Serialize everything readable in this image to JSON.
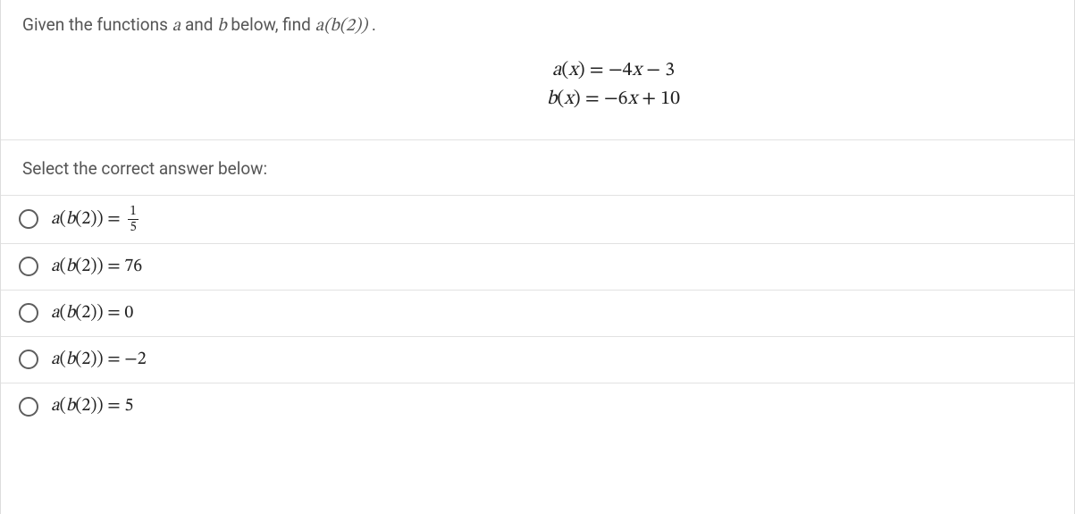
{
  "question": {
    "prefix": "Given the functions ",
    "var_a": "a",
    "mid1": " and ",
    "var_b": "b",
    "mid2": " below, find ",
    "expr": "a(b(2))",
    "suffix": "."
  },
  "equations": {
    "line1": "a(x) = −4x − 3",
    "line2": "b(x) = −6x + 10"
  },
  "prompt": "Select the correct answer below:",
  "options": [
    {
      "lhs": "a(b(2)) = ",
      "rhs_type": "frac",
      "num": "1",
      "den": "5"
    },
    {
      "lhs": "a(b(2)) = ",
      "rhs_type": "plain",
      "rhs": "76"
    },
    {
      "lhs": "a(b(2)) = ",
      "rhs_type": "plain",
      "rhs": "0"
    },
    {
      "lhs": "a(b(2)) = ",
      "rhs_type": "plain",
      "rhs": "−2"
    },
    {
      "lhs": "a(b(2)) = ",
      "rhs_type": "plain",
      "rhs": "5"
    }
  ]
}
